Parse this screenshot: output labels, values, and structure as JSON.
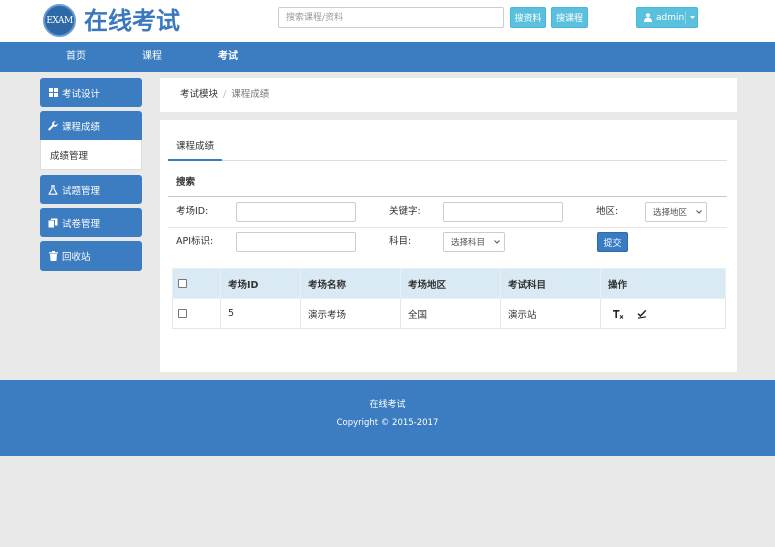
{
  "theme": {
    "primary": "#3c7cc0",
    "info": "#5bc0de",
    "background": "#e9e9e9"
  },
  "header": {
    "logo_text": "EXAM",
    "site_title": "在线考试",
    "search": {
      "placeholder": "搜索课程/资料",
      "value": ""
    },
    "search_materials_label": "搜资料",
    "search_courses_label": "搜课程",
    "user": {
      "name": "admin",
      "icon": "user-icon"
    }
  },
  "nav": {
    "items": [
      {
        "label": "首页",
        "active": false
      },
      {
        "label": "课程",
        "active": false
      },
      {
        "label": "考试",
        "active": true
      }
    ]
  },
  "sidebar": {
    "items": [
      {
        "label": "考试设计",
        "icon": "grid-icon"
      },
      {
        "label": "课程成绩",
        "icon": "wrench-icon",
        "expanded": true,
        "children": [
          {
            "label": "成绩管理",
            "active": true
          }
        ]
      },
      {
        "label": "试题管理",
        "icon": "flask-icon"
      },
      {
        "label": "试卷管理",
        "icon": "copy-icon"
      },
      {
        "label": "回收站",
        "icon": "trash-icon"
      }
    ]
  },
  "breadcrumb": {
    "items": [
      "考试模块",
      "课程成绩"
    ],
    "separator": "/"
  },
  "main": {
    "tabs": [
      {
        "label": "课程成绩",
        "active": true
      }
    ],
    "search": {
      "title": "搜索",
      "fields": {
        "room_id": {
          "label": "考场ID:",
          "value": ""
        },
        "keyword": {
          "label": "关键字:",
          "value": ""
        },
        "region": {
          "label": "地区:",
          "selected": "选择地区"
        },
        "api_id": {
          "label": "API标识:",
          "value": ""
        },
        "subject": {
          "label": "科目:",
          "selected": "选择科目"
        }
      },
      "submit_label": "提交"
    },
    "table": {
      "columns": [
        "考场ID",
        "考场名称",
        "考场地区",
        "考试科目",
        "操作"
      ],
      "select_all_checked": false,
      "rows": [
        {
          "checked": false,
          "id": "5",
          "name": "演示考场",
          "region": "全国",
          "subject": "演示站",
          "actions": [
            "text-size-icon",
            "check-icon"
          ]
        }
      ]
    }
  },
  "footer": {
    "title": "在线考试",
    "copyright": "Copyright © 2015-2017"
  }
}
